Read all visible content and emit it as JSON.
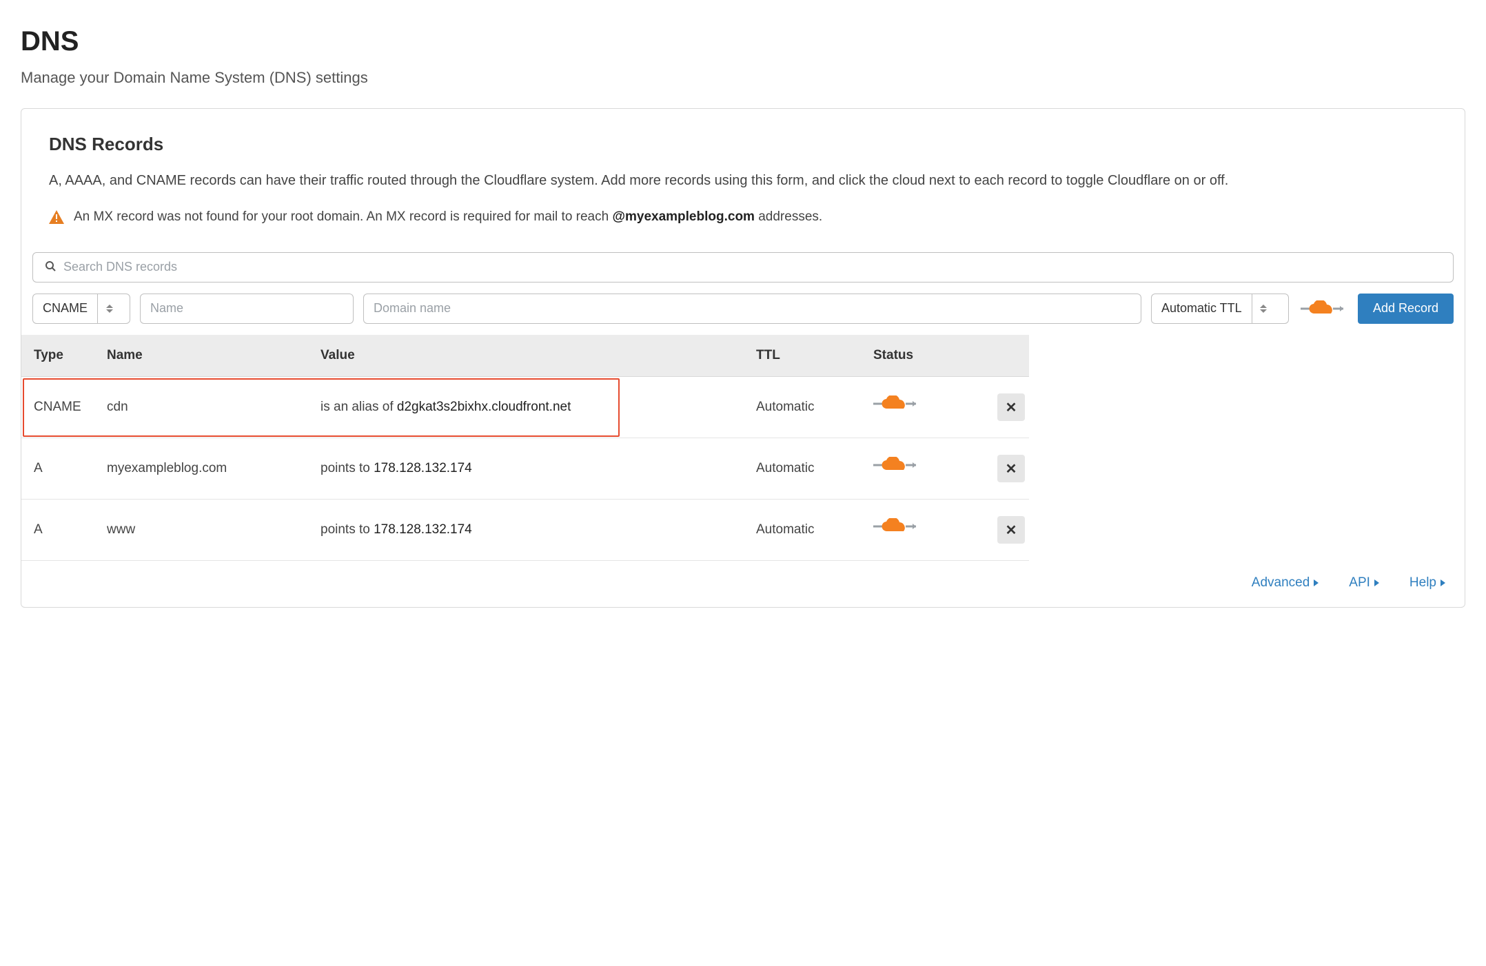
{
  "header": {
    "title": "DNS",
    "subtitle": "Manage your Domain Name System (DNS) settings"
  },
  "section": {
    "title": "DNS Records",
    "description": "A, AAAA, and CNAME records can have their traffic routed through the Cloudflare system. Add more records using this form, and click the cloud next to each record to toggle Cloudflare on or off."
  },
  "notice": {
    "text_before": "An MX record was not found for your root domain. An MX record is required for mail to reach ",
    "domain": "@myexampleblog.com",
    "text_after": " addresses."
  },
  "search": {
    "placeholder": "Search DNS records"
  },
  "add_form": {
    "type_value": "CNAME",
    "name_placeholder": "Name",
    "value_placeholder": "Domain name",
    "ttl_value": "Automatic TTL",
    "button": "Add Record"
  },
  "table": {
    "headers": {
      "type": "Type",
      "name": "Name",
      "value": "Value",
      "ttl": "TTL",
      "status": "Status"
    },
    "rows": [
      {
        "type": "CNAME",
        "name": "cdn",
        "value_pre": "is an alias of ",
        "value_main": "d2gkat3s2bixhx.cloudfront.net",
        "ttl": "Automatic",
        "highlighted": true
      },
      {
        "type": "A",
        "name": "myexampleblog.com",
        "value_pre": "points to ",
        "value_main": "178.128.132.174",
        "ttl": "Automatic",
        "highlighted": false
      },
      {
        "type": "A",
        "name": "www",
        "value_pre": "points to ",
        "value_main": "178.128.132.174",
        "ttl": "Automatic",
        "highlighted": false
      }
    ]
  },
  "footer": {
    "advanced": "Advanced",
    "api": "API",
    "help": "Help"
  }
}
